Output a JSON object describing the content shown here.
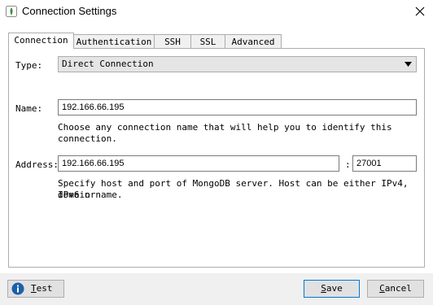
{
  "window": {
    "title": "Connection Settings",
    "icon": "mongodb-leaf-icon",
    "close_icon": "close-icon"
  },
  "tabs": [
    {
      "label": "Connection",
      "active": true
    },
    {
      "label": "Authentication",
      "active": false
    },
    {
      "label": "SSH",
      "active": false
    },
    {
      "label": "SSL",
      "active": false
    },
    {
      "label": "Advanced",
      "active": false
    }
  ],
  "form": {
    "type_label": "Type:",
    "type_value": "Direct Connection",
    "name_label": "Name:",
    "name_value": "192.166.66.195",
    "name_hint": "Choose any connection name that will help you to identify this connection.",
    "address_label": "Address:",
    "host_value": "192.166.66.195",
    "port_separator": ":",
    "port_value": "27001",
    "address_hint_line1": "Specify host and port of MongoDB server. Host can be either IPv4, IPv6 or",
    "address_hint_line2": "domain name."
  },
  "buttons": {
    "test_mnemonic": "T",
    "test_rest": "est",
    "save_mnemonic": "S",
    "save_rest": "ave",
    "cancel_mnemonic": "C",
    "cancel_rest": "ancel"
  },
  "colors": {
    "accent": "#0078d7",
    "info_icon": "#1c5fa8"
  }
}
